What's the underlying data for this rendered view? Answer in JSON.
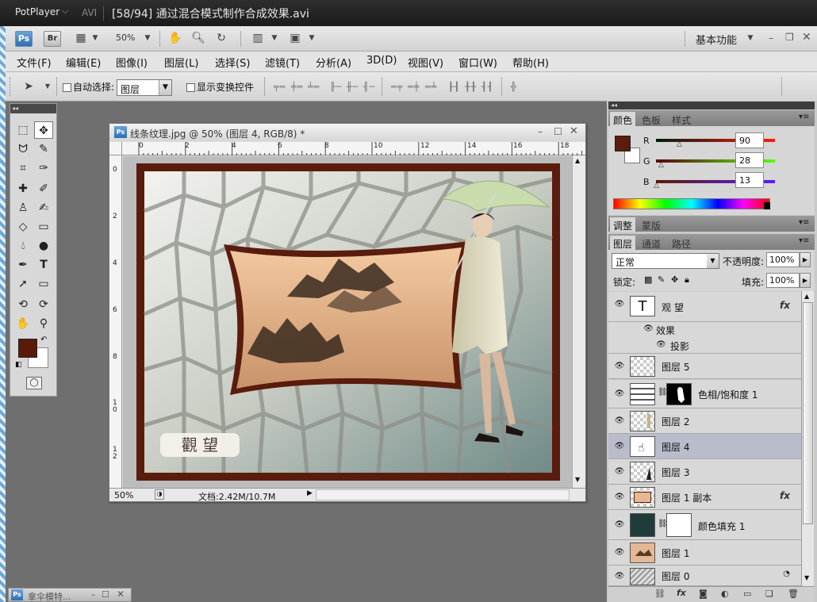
{
  "potplayer": {
    "app_name": "PotPlayer",
    "format": "AVI",
    "title": "[58/94] 通过混合模式制作合成效果.avi"
  },
  "appbar": {
    "ps_label": "Ps",
    "br_label": "Br",
    "zoom": "50%",
    "workspace": "基本功能"
  },
  "menu": [
    "文件(F)",
    "编辑(E)",
    "图像(I)",
    "图层(L)",
    "选择(S)",
    "滤镜(T)",
    "分析(A)",
    "3D(D)",
    "视图(V)",
    "窗口(W)",
    "帮助(H)"
  ],
  "options": {
    "auto_select_label": "自动选择:",
    "auto_select_value": "图层",
    "show_transform_label": "显示变换控件"
  },
  "document": {
    "title": "线条纹理.jpg @ 50% (图层 4, RGB/8) *",
    "zoom": "50%",
    "doc_size": "文档:2.42M/10.7M",
    "ruler_top": [
      "0",
      "2",
      "4",
      "6",
      "8",
      "10",
      "12",
      "14",
      "16",
      "18"
    ],
    "ruler_left": [
      "0",
      "2",
      "4",
      "6",
      "8",
      "1 0",
      "1 2"
    ],
    "seal_text": "觀 望"
  },
  "minimized_doc": {
    "ps_label": "Ps",
    "title": "拿伞模特..."
  },
  "color_panel": {
    "tabs": [
      "颜色",
      "色板",
      "样式"
    ],
    "channels": [
      {
        "label": "R",
        "value": "90"
      },
      {
        "label": "G",
        "value": "28"
      },
      {
        "label": "B",
        "value": "13"
      }
    ],
    "foreground": "#5a1c0d"
  },
  "adjust_tabs": [
    "调整",
    "蒙版"
  ],
  "layers_panel": {
    "tabs": [
      "图层",
      "通道",
      "路径"
    ],
    "blend_mode": "正常",
    "opacity_label": "不透明度:",
    "opacity": "100%",
    "lock_label": "锁定:",
    "fill_label": "填充:",
    "fill": "100%",
    "layers": [
      {
        "name": "观 望",
        "kind": "text",
        "fx": "fx"
      },
      {
        "name": "效果",
        "kind": "effect-group"
      },
      {
        "name": "投影",
        "kind": "effect"
      },
      {
        "name": "图层 5",
        "kind": "transparent"
      },
      {
        "name": "色相/饱和度 1",
        "kind": "adjustment"
      },
      {
        "name": "图层 2",
        "kind": "figure"
      },
      {
        "name": "图层 4",
        "kind": "selected"
      },
      {
        "name": "图层 3",
        "kind": "figure-dark"
      },
      {
        "name": "图层 1 副本",
        "kind": "painting",
        "fx": "fx"
      },
      {
        "name": "颜色填充 1",
        "kind": "fill"
      },
      {
        "name": "图层 1",
        "kind": "painting"
      },
      {
        "name": "图层 0",
        "kind": "texture"
      }
    ],
    "text_thumb": "T"
  }
}
